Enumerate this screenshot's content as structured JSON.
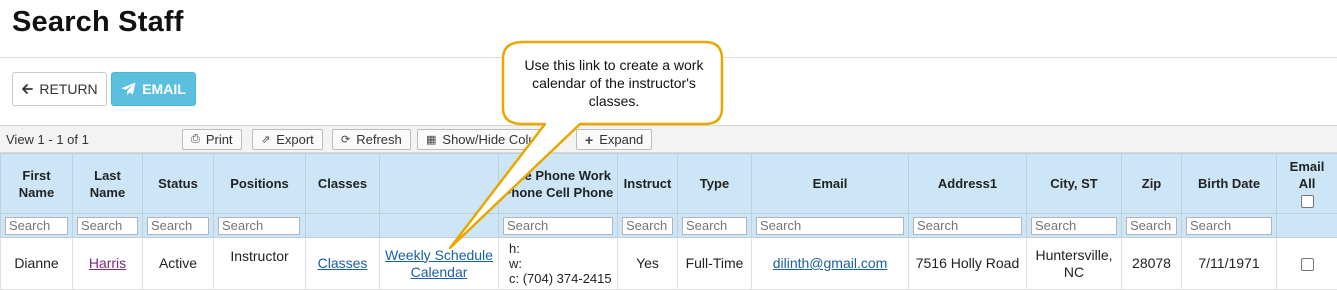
{
  "page": {
    "title": "Search Staff"
  },
  "buttons": {
    "return_label": "RETURN",
    "email_label": "EMAIL"
  },
  "toolbar": {
    "view_text": "View 1 - 1 of 1",
    "print": "Print",
    "export": "Export",
    "refresh": "Refresh",
    "showhide": "Show/Hide Colu",
    "expand": "Expand"
  },
  "callout": {
    "text": "Use this link to create a work calendar of the instructor's classes.",
    "border_color": "#e8a800"
  },
  "columns": {
    "first_name": "First Name",
    "last_name": "Last Name",
    "status": "Status",
    "positions": "Positions",
    "classes": "Classes",
    "schedule": "",
    "phones": "ome Phone Work Phone Cell Phone",
    "instruct": "Instruct",
    "type": "Type",
    "email": "Email",
    "address1": "Address1",
    "city_st": "City, ST",
    "zip": "Zip",
    "birth_date": "Birth Date",
    "email_all": "Email All"
  },
  "filters": {
    "placeholder": "Search"
  },
  "row": {
    "first_name": "Dianne",
    "last_name": "Harris",
    "status": "Active",
    "positions": "Instructor",
    "classes_link": "Classes",
    "schedule_link": "Weekly Schedule Calendar",
    "phone_home": "h:",
    "phone_work": "w:",
    "phone_cell": "c: (704) 374-2415",
    "instruct": "Yes",
    "type": "Full-Time",
    "email": "dilinth@gmail.com",
    "address1": "7516 Holly Road",
    "city_st": "Huntersville, NC",
    "zip": "28078",
    "birth_date": "7/11/1971"
  },
  "colors": {
    "header_bg": "#cde6f7",
    "email_button": "#5bc0de",
    "link": "#1a5fa8",
    "visited_link": "#7a2b7f"
  }
}
